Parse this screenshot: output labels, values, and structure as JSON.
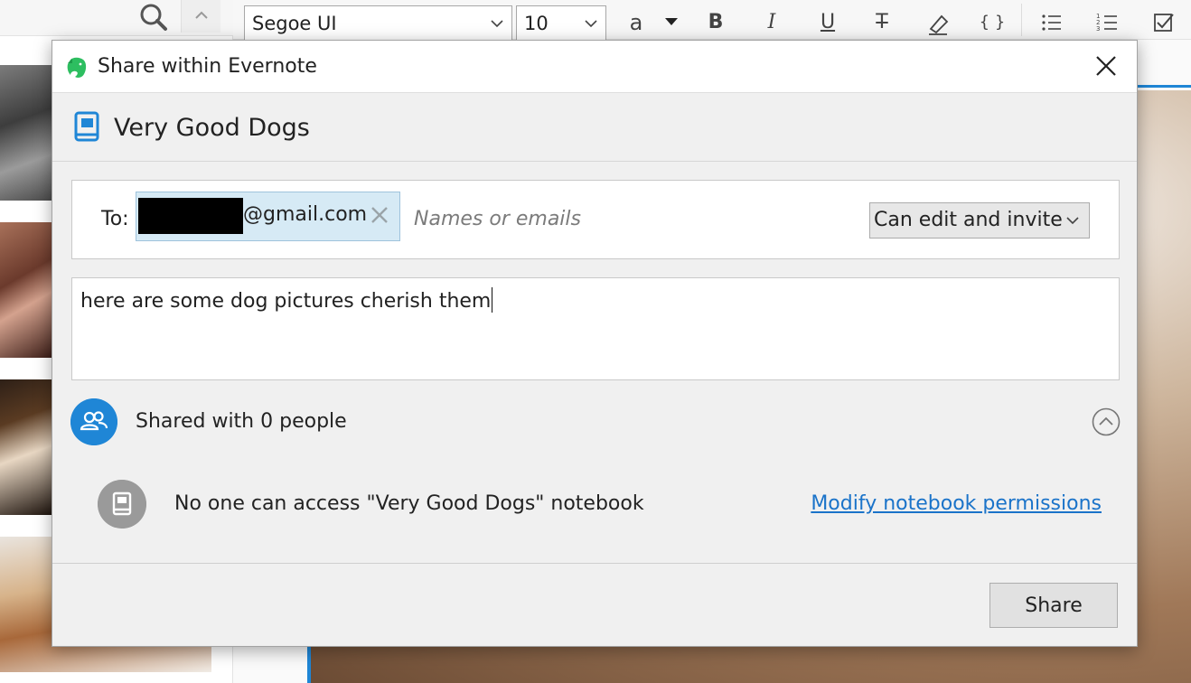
{
  "background": {
    "toolbar": {
      "font_family_value": "Segoe UI",
      "font_size_value": "10",
      "text_color_glyph": "a",
      "bold_glyph": "B",
      "italic_glyph": "I",
      "underline_glyph": "U",
      "strike_glyph": "T",
      "code_glyph": "{ }"
    }
  },
  "dialog": {
    "title": "Share within Evernote",
    "notebook_name": "Very Good Dogs",
    "to_label": "To:",
    "recipient_chip_text": "@gmail.com",
    "recipient_placeholder": "Names or emails",
    "permission_value": "Can edit and invite",
    "message_text": "here are some dog pictures cherish them",
    "shared_with_text": "Shared with 0 people",
    "access_text": "No one can access \"Very Good Dogs\" notebook",
    "modify_link": "Modify notebook permissions",
    "share_button": "Share"
  },
  "colors": {
    "accent_blue": "#1f86d6",
    "evernote_green": "#2dbe60",
    "link_blue": "#1a73c9",
    "chip_bg": "#d6eaf5"
  }
}
